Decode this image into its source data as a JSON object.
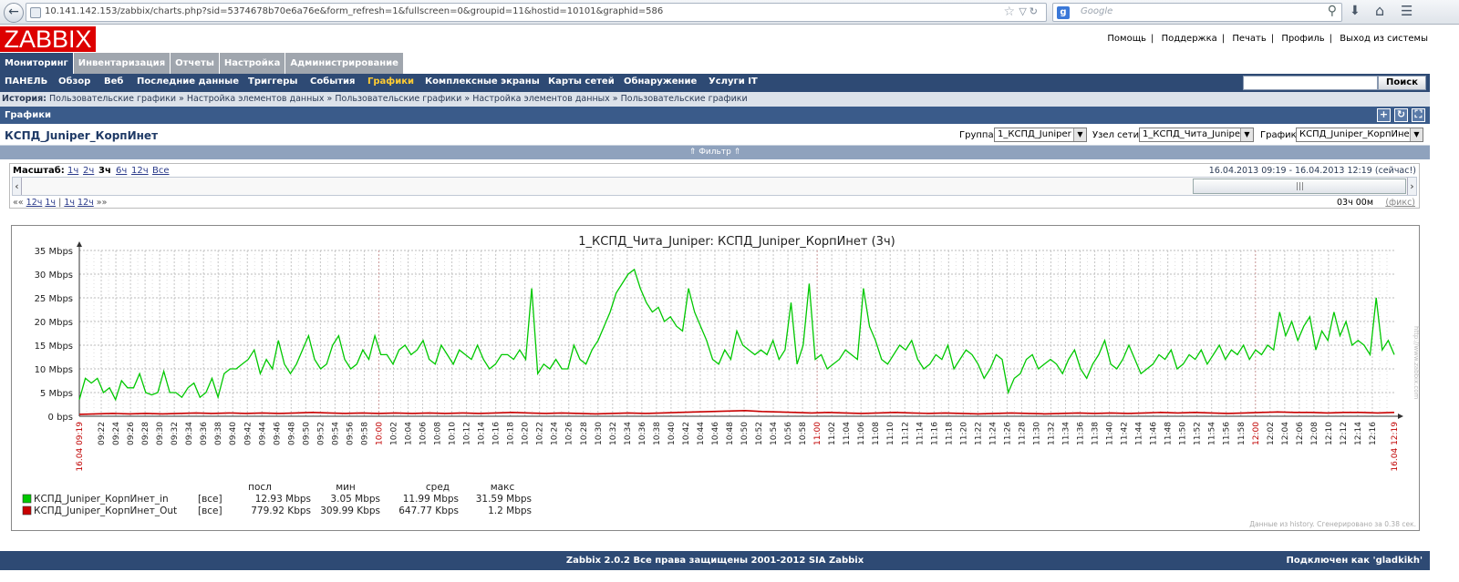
{
  "browser": {
    "url": "10.141.142.153/zabbix/charts.php?sid=5374678b70e6a76e&form_refresh=1&fullscreen=0&groupid=11&hostid=10101&graphid=586",
    "search_placeholder": "Google"
  },
  "header": {
    "logo": "ZABBIX",
    "links": [
      "Помощь",
      "Поддержка",
      "Печать",
      "Профиль",
      "Выход из системы"
    ]
  },
  "main_tabs": [
    "Мониторинг",
    "Инвентаризация",
    "Отчеты",
    "Настройка",
    "Администрирование"
  ],
  "sub_menu": [
    "ПАНЕЛЬ",
    "Обзор",
    "Веб",
    "Последние данные",
    "Триггеры",
    "События",
    "Графики",
    "Комплексные экраны",
    "Карты сетей",
    "Обнаружение",
    "Услуги IT"
  ],
  "search_button": "Поиск",
  "history": {
    "label": "История:",
    "items": [
      "Пользовательские графики",
      "Настройка элементов данных",
      "Пользовательские графики",
      "Настройка элементов данных",
      "Пользовательские графики"
    ]
  },
  "page_header": "Графики",
  "graph_title_name": "КСПД_Juniper_КорпИнет",
  "selectors": {
    "group_label": "Группа",
    "group_value": "1_КСПД_Juniper",
    "host_label": "Узел сети",
    "host_value": "1_КСПД_Чита_Juniper",
    "graph_label": "График",
    "graph_value": "КСПД_Juniper_КорпИнет"
  },
  "filter": "Фильтр",
  "scale": {
    "label": "Масштаб:",
    "options": [
      "1ч",
      "2ч",
      "3ч",
      "6ч",
      "12ч",
      "Все"
    ],
    "active": "3ч",
    "range": "16.04.2013 09:19  -  16.04.2013 12:19 (сейчас!)",
    "nav_left": [
      "««",
      "12ч",
      "1ч",
      "|",
      "1ч",
      "12ч",
      "»»"
    ],
    "duration": "03ч 00м",
    "fix": "(фикс)"
  },
  "footer": {
    "copyright": "Zabbix 2.0.2 Все права защищены 2001-2012 SIA Zabbix",
    "connected": "Подключен как 'gladkikh'"
  },
  "colors": {
    "in": "#00c800",
    "out": "#c80000",
    "nav": "#2e4a74",
    "logo": "#dd0000"
  },
  "chart_data": {
    "type": "line",
    "title": "1_КСПД_Чита_Juniper: КСПД_Juniper_КорпИнет (3ч)",
    "ylim": [
      0,
      35
    ],
    "y_unit": "Mbps",
    "y_ticks": [
      "0 bps",
      "5 Mbps",
      "10 Mbps",
      "15 Mbps",
      "20 Mbps",
      "25 Mbps",
      "30 Mbps",
      "35 Mbps"
    ],
    "x_start": "16.04 09:19",
    "x_end": "16.04 12:19",
    "x_ticks": [
      "09:22",
      "09:24",
      "09:26",
      "09:28",
      "09:30",
      "09:32",
      "09:34",
      "09:36",
      "09:38",
      "09:40",
      "09:42",
      "09:44",
      "09:46",
      "09:48",
      "09:50",
      "09:52",
      "09:54",
      "09:56",
      "09:58",
      "10:00",
      "10:02",
      "10:04",
      "10:06",
      "10:08",
      "10:10",
      "10:12",
      "10:14",
      "10:16",
      "10:18",
      "10:20",
      "10:22",
      "10:24",
      "10:26",
      "10:28",
      "10:30",
      "10:32",
      "10:34",
      "10:36",
      "10:38",
      "10:40",
      "10:42",
      "10:44",
      "10:46",
      "10:48",
      "10:50",
      "10:52",
      "10:54",
      "10:56",
      "10:58",
      "11:00",
      "11:02",
      "11:04",
      "11:06",
      "11:08",
      "11:10",
      "11:12",
      "11:14",
      "11:16",
      "11:18",
      "11:20",
      "11:22",
      "11:24",
      "11:26",
      "11:28",
      "11:30",
      "11:32",
      "11:34",
      "11:36",
      "11:38",
      "11:40",
      "11:42",
      "11:44",
      "11:46",
      "11:48",
      "11:50",
      "11:52",
      "11:54",
      "11:56",
      "11:58",
      "12:00",
      "12:02",
      "12:04",
      "12:06",
      "12:08",
      "12:10",
      "12:12",
      "12:14",
      "12:16"
    ],
    "legend_headers": [
      "посл",
      "мин",
      "сред",
      "макс"
    ],
    "series": [
      {
        "name": "КСПД_Juniper_КорпИнет_in",
        "func": "[все]",
        "last": "12.93 Mbps",
        "min": "3.05 Mbps",
        "avg": "11.99 Mbps",
        "max": "31.59 Mbps",
        "values": [
          3.5,
          8,
          7,
          8,
          5,
          6,
          3.5,
          7.5,
          6,
          6,
          9,
          5,
          4.5,
          5,
          9.5,
          5,
          5,
          4,
          6,
          7,
          4,
          5,
          8,
          4,
          9,
          10,
          10,
          11,
          12,
          14,
          9,
          12,
          10,
          16,
          11,
          9,
          11,
          14,
          17,
          12,
          10,
          11,
          15,
          17,
          12,
          10,
          11,
          14,
          12,
          17,
          13,
          13,
          11,
          14,
          15,
          13,
          14,
          16,
          12,
          11,
          15,
          13,
          11,
          14,
          13,
          12,
          15,
          12,
          10,
          11,
          13,
          13,
          12,
          14,
          12,
          27,
          9,
          11,
          10,
          12,
          10,
          10,
          15,
          12,
          11,
          14,
          16,
          19,
          22,
          26,
          28,
          30,
          31,
          27,
          24,
          22,
          23,
          20,
          21,
          19,
          18,
          27,
          22,
          19,
          16,
          12,
          11,
          14,
          12,
          18,
          15,
          14,
          13,
          14,
          13,
          16,
          12,
          14,
          24,
          11,
          15,
          28,
          12,
          13,
          10,
          11,
          12,
          14,
          13,
          12,
          27,
          19,
          16,
          12,
          11,
          13,
          15,
          14,
          16,
          12,
          10,
          11,
          13,
          12,
          15,
          10,
          12,
          14,
          13,
          11,
          8,
          10,
          13,
          12,
          5,
          8,
          9,
          12,
          13,
          10,
          11,
          12,
          11,
          9,
          12,
          14,
          10,
          8,
          11,
          13,
          16,
          11,
          10,
          12,
          15,
          12,
          9,
          10,
          11,
          13,
          12,
          14,
          10,
          11,
          13,
          12,
          14,
          11,
          13,
          15,
          12,
          14,
          13,
          15,
          12,
          14,
          13,
          15,
          14,
          22,
          17,
          20,
          16,
          19,
          21,
          14,
          18,
          16,
          22,
          17,
          20,
          15,
          16,
          15,
          13,
          25,
          14,
          16,
          13
        ],
        "color": "#00c800"
      },
      {
        "name": "КСПД_Juniper_КорпИнет_Out",
        "func": "[все]",
        "last": "779.92 Kbps",
        "min": "309.99 Kbps",
        "avg": "647.77 Kbps",
        "max": "1.2 Mbps",
        "values": [
          0.4,
          0.5,
          0.6,
          0.5,
          0.6,
          0.5,
          0.6,
          0.7,
          0.6,
          0.7,
          0.6,
          0.7,
          0.6,
          0.7,
          0.8,
          0.7,
          0.6,
          0.7,
          0.6,
          0.7,
          0.6,
          0.7,
          0.6,
          0.7,
          0.6,
          0.7,
          0.8,
          0.7,
          0.6,
          0.7,
          0.6,
          0.5,
          0.6,
          0.7,
          0.6,
          0.7,
          0.8,
          0.9,
          1.0,
          1.1,
          1.2,
          1.0,
          0.9,
          0.8,
          0.7,
          0.8,
          0.7,
          0.6,
          0.7,
          0.8,
          0.7,
          0.6,
          0.7,
          0.6,
          0.5,
          0.6,
          0.7,
          0.6,
          0.5,
          0.6,
          0.7,
          0.6,
          0.7,
          0.6,
          0.7,
          0.8,
          0.7,
          0.8,
          0.7,
          0.6,
          0.7,
          0.8,
          0.9,
          0.8,
          0.8,
          0.7,
          0.8,
          0.8,
          0.7,
          0.8
        ],
        "color": "#c80000"
      }
    ],
    "footnote": "Данные из history. Сгенерировано за 0.38 сек.",
    "watermark": "http://www.zabbix.com",
    "grid": true
  }
}
